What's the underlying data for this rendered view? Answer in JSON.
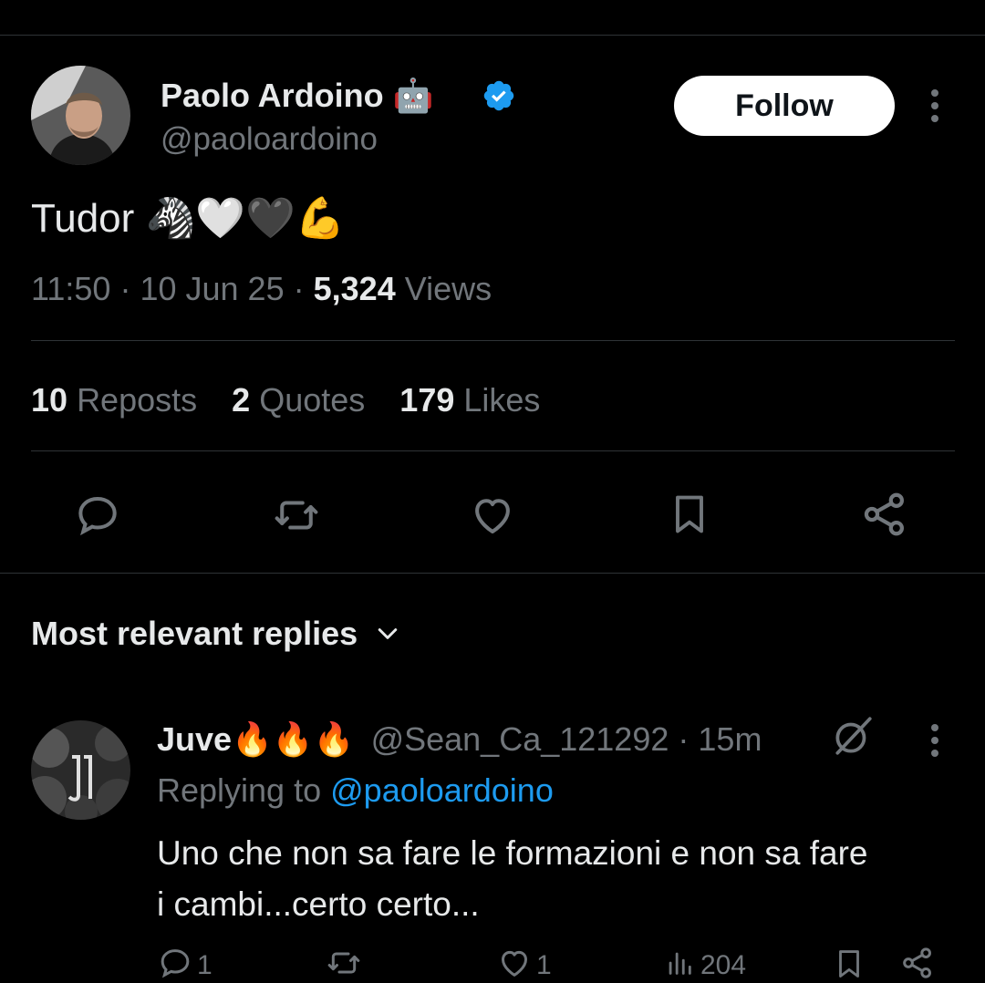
{
  "tweet": {
    "author": {
      "name": "Paolo Ardoino",
      "name_emoji": "🤖",
      "handle": "@paoloardoino"
    },
    "follow_label": "Follow",
    "text": "Tudor",
    "text_emoji": "🦓🤍🖤💪",
    "time": "11:50",
    "sep1": "·",
    "date": "10 Jun 25",
    "sep2": "·",
    "views_count": "5,324",
    "views_label": "Views",
    "stats": {
      "reposts_count": "10",
      "reposts_label": "Reposts",
      "quotes_count": "2",
      "quotes_label": "Quotes",
      "likes_count": "179",
      "likes_label": "Likes"
    }
  },
  "replies_header": {
    "label": "Most relevant replies"
  },
  "reply": {
    "name": "Juve",
    "name_emoji": "🔥🔥🔥",
    "handle": "@Sean_Ca_121292",
    "sep": "·",
    "time": "15m",
    "replying_prefix": "Replying to",
    "replying_handle": "@paoloardoino",
    "text_line1": "Uno che non sa fare le formazioni e non sa fare",
    "text_line2": "i cambi...certo certo...",
    "reply_count": "1",
    "like_count": "1",
    "view_count": "204",
    "avatar_text": "JUVENTUS"
  },
  "colors": {
    "background": "#000000",
    "text": "#e7e9ea",
    "muted": "#71767b",
    "link": "#1d9bf0",
    "verified": "#1d9bf0",
    "divider": "#2f3336"
  }
}
